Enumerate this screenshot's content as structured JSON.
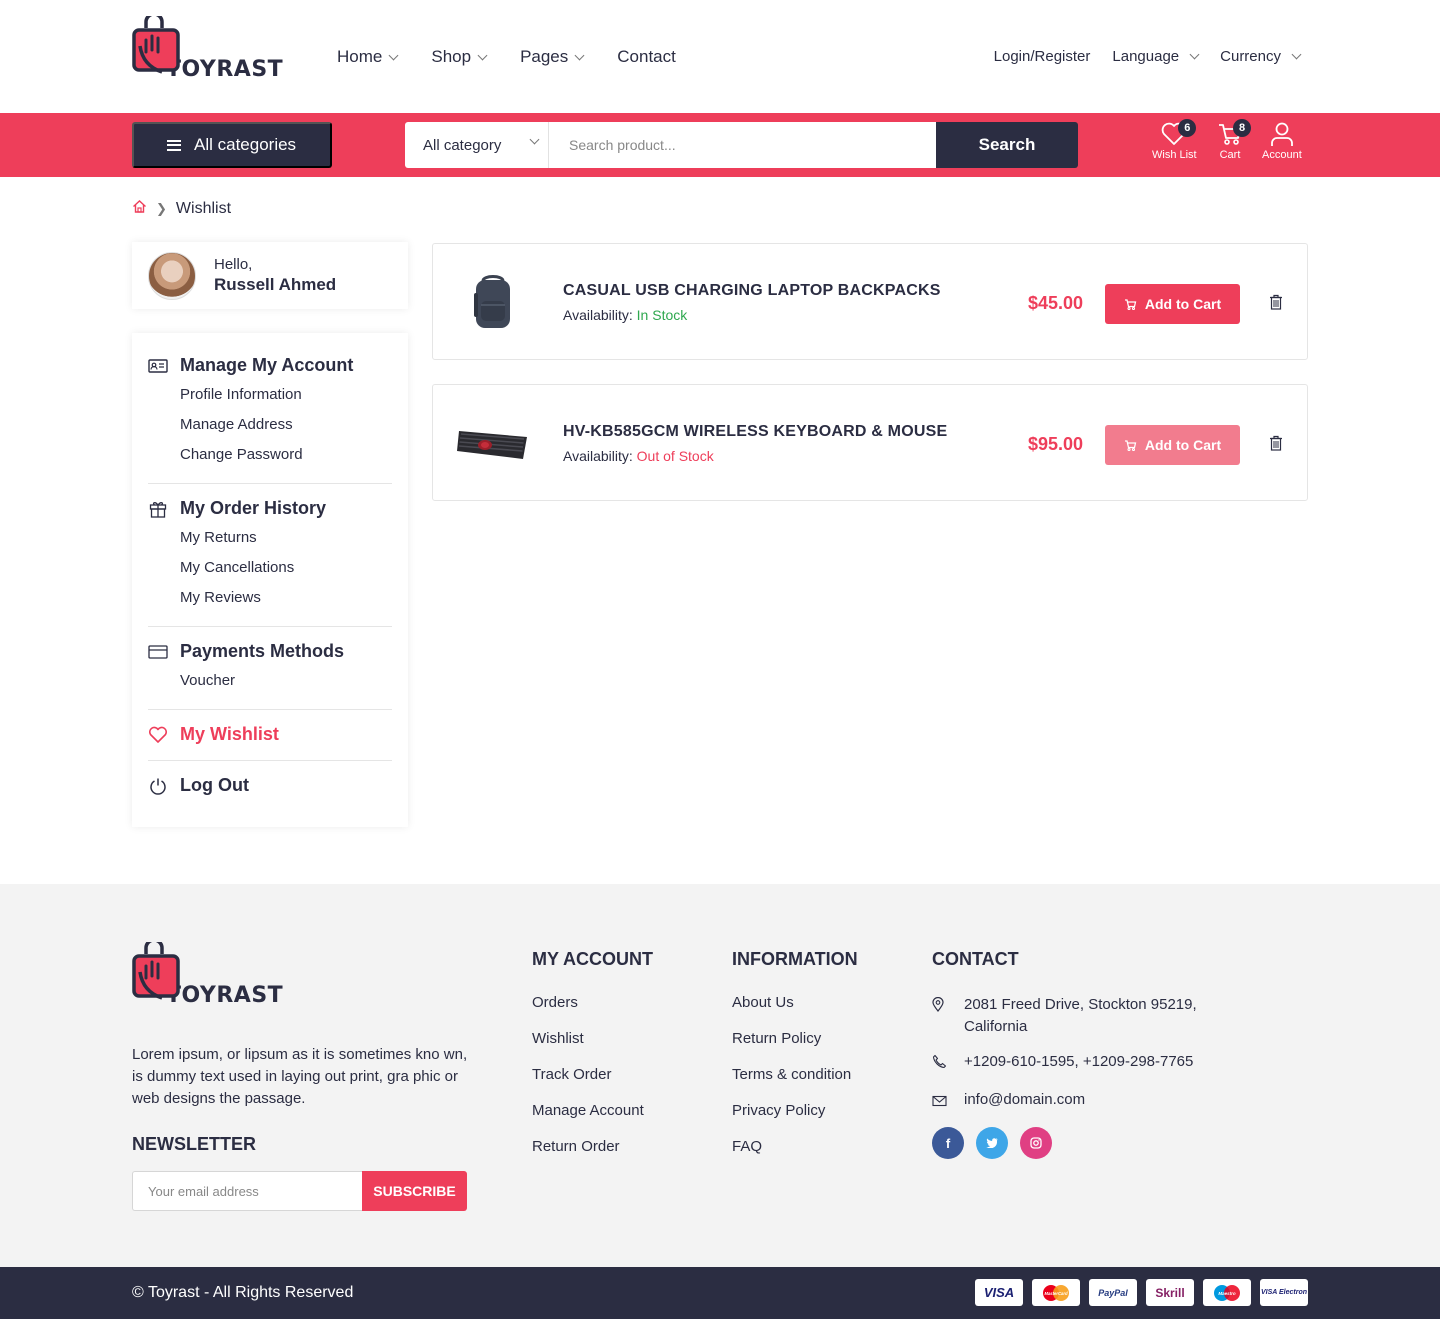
{
  "brand": {
    "name": "TOYRAST"
  },
  "nav": {
    "items": [
      {
        "label": "Home"
      },
      {
        "label": "Shop"
      },
      {
        "label": "Pages"
      },
      {
        "label": "Contact"
      }
    ],
    "login": "Login/Register",
    "language": "Language",
    "currency": "Currency"
  },
  "searchbar": {
    "all_categories": "All categories",
    "category_select": "All category",
    "placeholder": "Search product...",
    "search_button": "Search",
    "wishlist": {
      "label": "Wish List",
      "count": "6"
    },
    "cart": {
      "label": "Cart",
      "count": "8"
    },
    "account": {
      "label": "Account"
    }
  },
  "breadcrumb": {
    "current": "Wishlist"
  },
  "profile": {
    "greeting": "Hello,",
    "name": "Russell Ahmed"
  },
  "sidebar": {
    "manage_account": {
      "title": "Manage My Account",
      "items": [
        "Profile Information",
        "Manage Address",
        "Change Password"
      ]
    },
    "order_history": {
      "title": "My Order History",
      "items": [
        "My Returns",
        "My Cancellations",
        "My Reviews"
      ]
    },
    "payments": {
      "title": "Payments Methods",
      "items": [
        "Voucher"
      ]
    },
    "wishlist": "My Wishlist",
    "logout": "Log Out",
    "colors": {
      "active": "#ee3e5a"
    }
  },
  "wishlist": {
    "availability_label": "Availability:",
    "add_to_cart": "Add to Cart",
    "items": [
      {
        "name": "CASUAL USB CHARGING LAPTOP BACKPACKS",
        "availability": "In Stock",
        "price": "$45.00"
      },
      {
        "name": "HV-KB585GCM WIRELESS KEYBOARD & MOUSE",
        "availability": "Out of Stock",
        "price": "$95.00"
      }
    ]
  },
  "footer": {
    "about": "Lorem ipsum, or lipsum as it is sometimes kno wn, is dummy text used in laying out print, gra phic or web designs the passage.",
    "newsletter": {
      "title": "NEWSLETTER",
      "placeholder": "Your email address",
      "button": "SUBSCRIBE"
    },
    "my_account": {
      "title": "MY ACCOUNT",
      "links": [
        "Orders",
        "Wishlist",
        "Track Order",
        "Manage Account",
        "Return Order"
      ]
    },
    "information": {
      "title": "INFORMATION",
      "links": [
        "About Us",
        "Return Policy",
        "Terms & condition",
        "Privacy Policy",
        "FAQ"
      ]
    },
    "contact": {
      "title": "CONTACT",
      "address": "2081 Freed Drive, Stockton 95219, California",
      "phone": "+1209-610-1595, +1209-298-7765",
      "email": "info@domain.com",
      "socials": [
        "facebook-icon",
        "twitter-icon",
        "instagram-icon"
      ]
    },
    "copyright": "© Toyrast - All Rights Reserved",
    "payment_methods": [
      "VISA",
      "MasterCard",
      "PayPal",
      "Skrill",
      "Maestro",
      "VISA Electron"
    ]
  },
  "colors": {
    "primary": "#ee3e5a",
    "dark": "#2b2d42",
    "in_stock": "#2fa84f"
  }
}
